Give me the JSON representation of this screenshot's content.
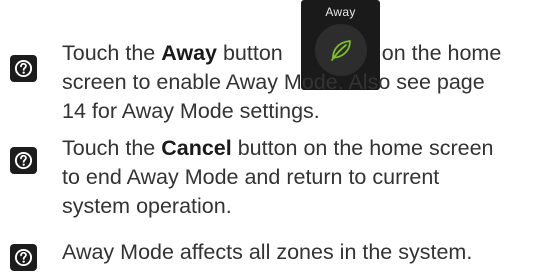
{
  "away_button": {
    "caption": "Away",
    "icon": "leaf-icon",
    "leaf_color": "#7fbf2a"
  },
  "tips": [
    {
      "icon": "question-icon",
      "before": "Touch the ",
      "bold": "Away",
      "after": " button",
      "after_image": "on the home",
      "line2": "screen to enable Away Mode. Also see page",
      "line3": "14 for Away Mode settings."
    },
    {
      "icon": "question-icon",
      "before": "Touch the ",
      "bold": "Cancel",
      "after": " button on the home screen",
      "line2": "to end Away Mode and return to current",
      "line3": "system operation."
    },
    {
      "icon": "question-icon",
      "text": "Away Mode affects all zones in the system."
    }
  ]
}
